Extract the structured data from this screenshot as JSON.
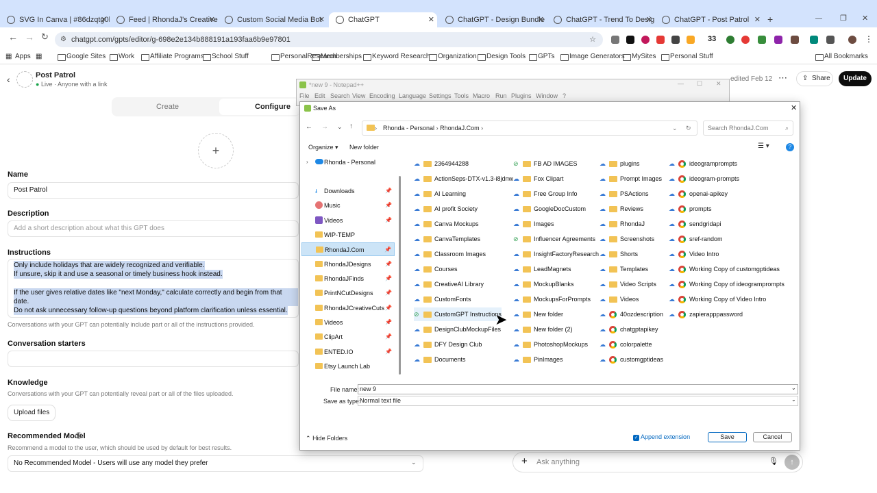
{
  "browser": {
    "tabs": [
      {
        "title": "SVG In Canva | #86dzqtg0k"
      },
      {
        "title": "Feed | RhondaJ's Creative Com"
      },
      {
        "title": "Custom Social Media Bot"
      },
      {
        "title": "ChatGPT"
      },
      {
        "title": "ChatGPT - Design Bundle & Li"
      },
      {
        "title": "ChatGPT - Trend To Design Ide"
      },
      {
        "title": "ChatGPT - Post Patrol"
      }
    ],
    "url": "chatgpt.com/gpts/editor/g-698e2e134b888191a193faa6b9e97801",
    "ext_count": "33",
    "bookmarks": [
      "Apps",
      "Google Sites",
      "Work",
      "Affiliate Programs",
      "School Stuff",
      "PersonalResearch",
      "Memberships",
      "Keyword Research",
      "Organization",
      "Design Tools",
      "GPTs",
      "Image Generators",
      "MySites",
      "Personal Stuff"
    ],
    "all_bookmarks": "All Bookmarks"
  },
  "gpt": {
    "name": "Post Patrol",
    "status": "Live",
    "access": "Anyone with a link",
    "edited": "edited Feb 12",
    "share": "Share",
    "update": "Update",
    "tab_create": "Create",
    "tab_configure": "Configure",
    "name_label": "Name",
    "name_value": "Post Patrol",
    "desc_label": "Description",
    "desc_placeholder": "Add a short description about what this GPT does",
    "instr_label": "Instructions",
    "instr_lines": [
      "Only include holidays that are widely recognized and verifiable.",
      "If unsure, skip it and use a seasonal or timely business hook instead.",
      "If the user gives relative dates like \"next Monday,\" calculate correctly and begin from that date.",
      "Do not ask unnecessary follow-up questions beyond platform clarification unless essential."
    ],
    "instr_note": "Conversations with your GPT can potentially include part or all of the instructions provided.",
    "starters_label": "Conversation starters",
    "knowledge_label": "Knowledge",
    "knowledge_note": "Conversations with your GPT can potentially reveal part or all of the files uploaded.",
    "upload": "Upload files",
    "model_label": "Recommended Model",
    "model_note": "Recommend a model to the user, which should be used by default for best results.",
    "model_value": "No Recommended Model - Users will use any model they prefer",
    "ask": "Ask anything"
  },
  "notepad": {
    "title": "*new 9 - Notepad++",
    "menu": [
      "File",
      "Edit",
      "Search",
      "View",
      "Encoding",
      "Language",
      "Settings",
      "Tools",
      "Macro",
      "Run",
      "Plugins",
      "Window",
      "?"
    ]
  },
  "dialog": {
    "title": "Save As",
    "crumbs": [
      "Rhonda - Personal",
      "RhondaJ.Com"
    ],
    "search_placeholder": "Search RhondaJ.Com",
    "organize": "Organize",
    "new_folder": "New folder",
    "nav": [
      {
        "label": "Rhonda - Personal"
      },
      {
        "label": "Downloads"
      },
      {
        "label": "Music"
      },
      {
        "label": "Videos"
      },
      {
        "label": "WIP-TEMP"
      },
      {
        "label": "RhondaJ.Com"
      },
      {
        "label": "RhondaJDesigns"
      },
      {
        "label": "RhondaJFinds"
      },
      {
        "label": "PrintNCutDesigns"
      },
      {
        "label": "RhondaJCreativeCuts"
      },
      {
        "label": "Videos"
      },
      {
        "label": "ClipArt"
      },
      {
        "label": "ENTED.IO"
      },
      {
        "label": "Etsy Launch Lab"
      }
    ],
    "columns": [
      [
        "2364944288",
        "ActionSeps-DTX-v1.3-i8jdnw",
        "AI Learning",
        "AI profit Society",
        "Canva Mockups",
        "CanvaTemplates",
        "Classroom Images",
        "Courses",
        "CreativeAI Library",
        "CustomFonts",
        "CustomGPT Instructions",
        "DesignClubMockupFiles",
        "DFY Design Club",
        "Documents"
      ],
      [
        "FB AD IMAGES",
        "Fox Clipart",
        "Free Group Info",
        "GoogleDocCustom",
        "Images",
        "Influencer Agreements",
        "InsightFactoryResearch",
        "LeadMagnets",
        "MockupBlanks",
        "MockupsForPrompts",
        "New folder",
        "New folder (2)",
        "PhotoshopMockups",
        "PinImages"
      ],
      [
        "plugins",
        "Prompt Images",
        "PSActions",
        "Reviews",
        "RhondaJ",
        "Screenshots",
        "Shorts",
        "Templates",
        "Video Scripts",
        "Videos",
        "40ozdescription",
        "chatgptapikey",
        "colorpalette",
        "customgptideas"
      ],
      [
        "ideogramprompts",
        "ideogram-prompts",
        "openai-apikey",
        "prompts",
        "sendgridapi",
        "sref-random",
        "Video Intro",
        "Working Copy of customgptideas",
        "Working Copy of ideogramprompts",
        "Working Copy of Video Intro",
        "zapierapppassword"
      ]
    ],
    "file_name_label": "File name:",
    "file_name": "new 9",
    "save_type_label": "Save as type:",
    "save_type": "Normal text file",
    "hide_folders": "Hide Folders",
    "append_ext": "Append extension",
    "save": "Save",
    "cancel": "Cancel"
  },
  "colors": {
    "accent": "#0067c0",
    "highlight": "#cce4f7",
    "tabbar": "#d3e3fd"
  }
}
